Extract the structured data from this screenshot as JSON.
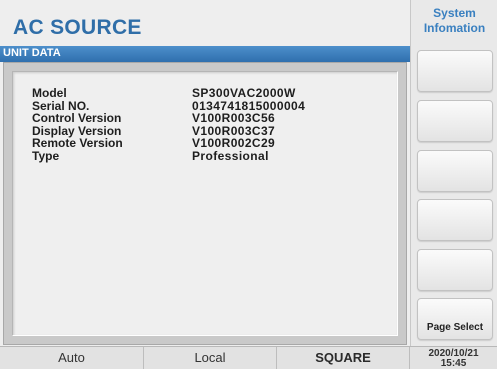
{
  "title": "AC SOURCE",
  "unit_header": "UNIT DATA",
  "unit_info": [
    {
      "label": "Model",
      "value": "SP300VAC2000W"
    },
    {
      "label": "Serial NO.",
      "value": "0134741815000004"
    },
    {
      "label": "Control Version",
      "value": "V100R003C56"
    },
    {
      "label": "Display Version",
      "value": "V100R003C37"
    },
    {
      "label": "Remote Version",
      "value": "V100R002C29"
    },
    {
      "label": "Type",
      "value": "Professional"
    }
  ],
  "side": {
    "title_line1": "System",
    "title_line2": "Infomation",
    "buttons": [
      "",
      "",
      "",
      "",
      "",
      "Page Select"
    ]
  },
  "status": {
    "mode": "Auto",
    "control": "Local",
    "waveform": "SQUARE",
    "date": "2020/10/21",
    "time": "15:45"
  }
}
